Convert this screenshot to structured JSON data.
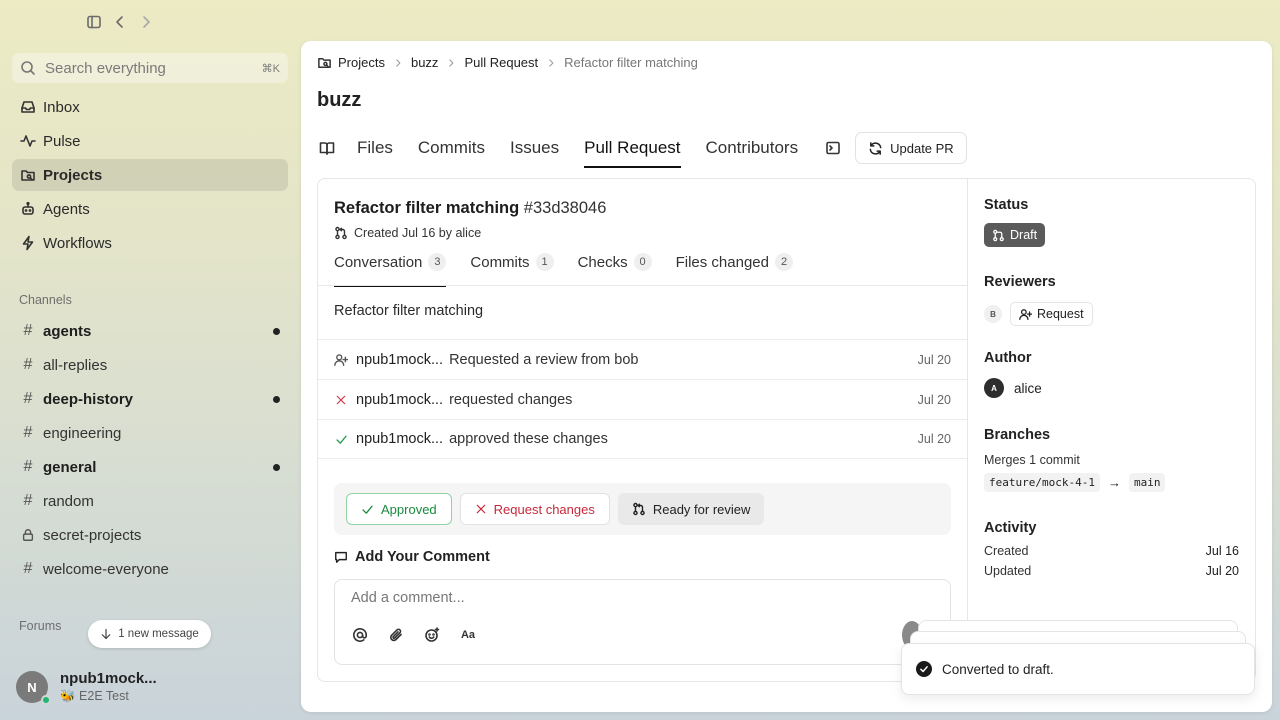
{
  "sidebar": {
    "search": {
      "placeholder": "Search everything",
      "shortcut": "⌘K"
    },
    "nav": [
      {
        "label": "Inbox",
        "icon": "inbox-icon"
      },
      {
        "label": "Pulse",
        "icon": "pulse-icon"
      },
      {
        "label": "Projects",
        "icon": "projects-icon",
        "active": true
      },
      {
        "label": "Agents",
        "icon": "agents-icon"
      },
      {
        "label": "Workflows",
        "icon": "workflows-icon"
      }
    ],
    "channels_label": "Channels",
    "channels": [
      {
        "name": "agents",
        "unread": true
      },
      {
        "name": "all-replies",
        "unread": false
      },
      {
        "name": "deep-history",
        "unread": true
      },
      {
        "name": "engineering",
        "unread": false
      },
      {
        "name": "general",
        "unread": true
      },
      {
        "name": "random",
        "unread": false
      },
      {
        "name": "secret-projects",
        "unread": false,
        "locked": true
      },
      {
        "name": "welcome-everyone",
        "unread": false
      }
    ],
    "forums_label": "Forums",
    "new_message": "1 new message",
    "user": {
      "initial": "N",
      "name": "npub1mock...",
      "status": "🐝 E2E Test"
    }
  },
  "breadcrumb": [
    "Projects",
    "buzz",
    "Pull Request",
    "Refactor filter matching"
  ],
  "page_title": "buzz",
  "tabs": [
    "Files",
    "Commits",
    "Issues",
    "Pull Request",
    "Contributors"
  ],
  "update_pr": "Update PR",
  "pr": {
    "title": "Refactor filter matching",
    "number": "#33d38046",
    "created": "Created Jul 16 by alice",
    "subtabs": [
      {
        "label": "Conversation",
        "count": "3"
      },
      {
        "label": "Commits",
        "count": "1"
      },
      {
        "label": "Checks",
        "count": "0"
      },
      {
        "label": "Files changed",
        "count": "2"
      }
    ],
    "description": "Refactor filter matching",
    "timeline": [
      {
        "who": "npub1mock...",
        "what": "Requested a review from bob",
        "date": "Jul 20",
        "icon": "user-plus-icon"
      },
      {
        "who": "npub1mock...",
        "what": "requested changes",
        "date": "Jul 20",
        "icon": "x-icon"
      },
      {
        "who": "npub1mock...",
        "what": "approved these changes",
        "date": "Jul 20",
        "icon": "check-icon"
      }
    ],
    "review_buttons": {
      "approved": "Approved",
      "changes": "Request changes",
      "ready": "Ready for review"
    },
    "comment_label": "Add Your Comment",
    "comment_placeholder": "Add a comment..."
  },
  "details": {
    "status_label": "Status",
    "status_value": "Draft",
    "reviewers_label": "Reviewers",
    "reviewer_initial": "B",
    "request_label": "Request",
    "author_label": "Author",
    "author_initial": "A",
    "author_name": "alice",
    "branches_label": "Branches",
    "merges": "Merges 1 commit",
    "from_branch": "feature/mock-4-1",
    "to_branch": "main",
    "activity_label": "Activity",
    "created_label": "Created",
    "created_value": "Jul 16",
    "updated_label": "Updated",
    "updated_value": "Jul 20"
  },
  "toast": "Converted to draft."
}
